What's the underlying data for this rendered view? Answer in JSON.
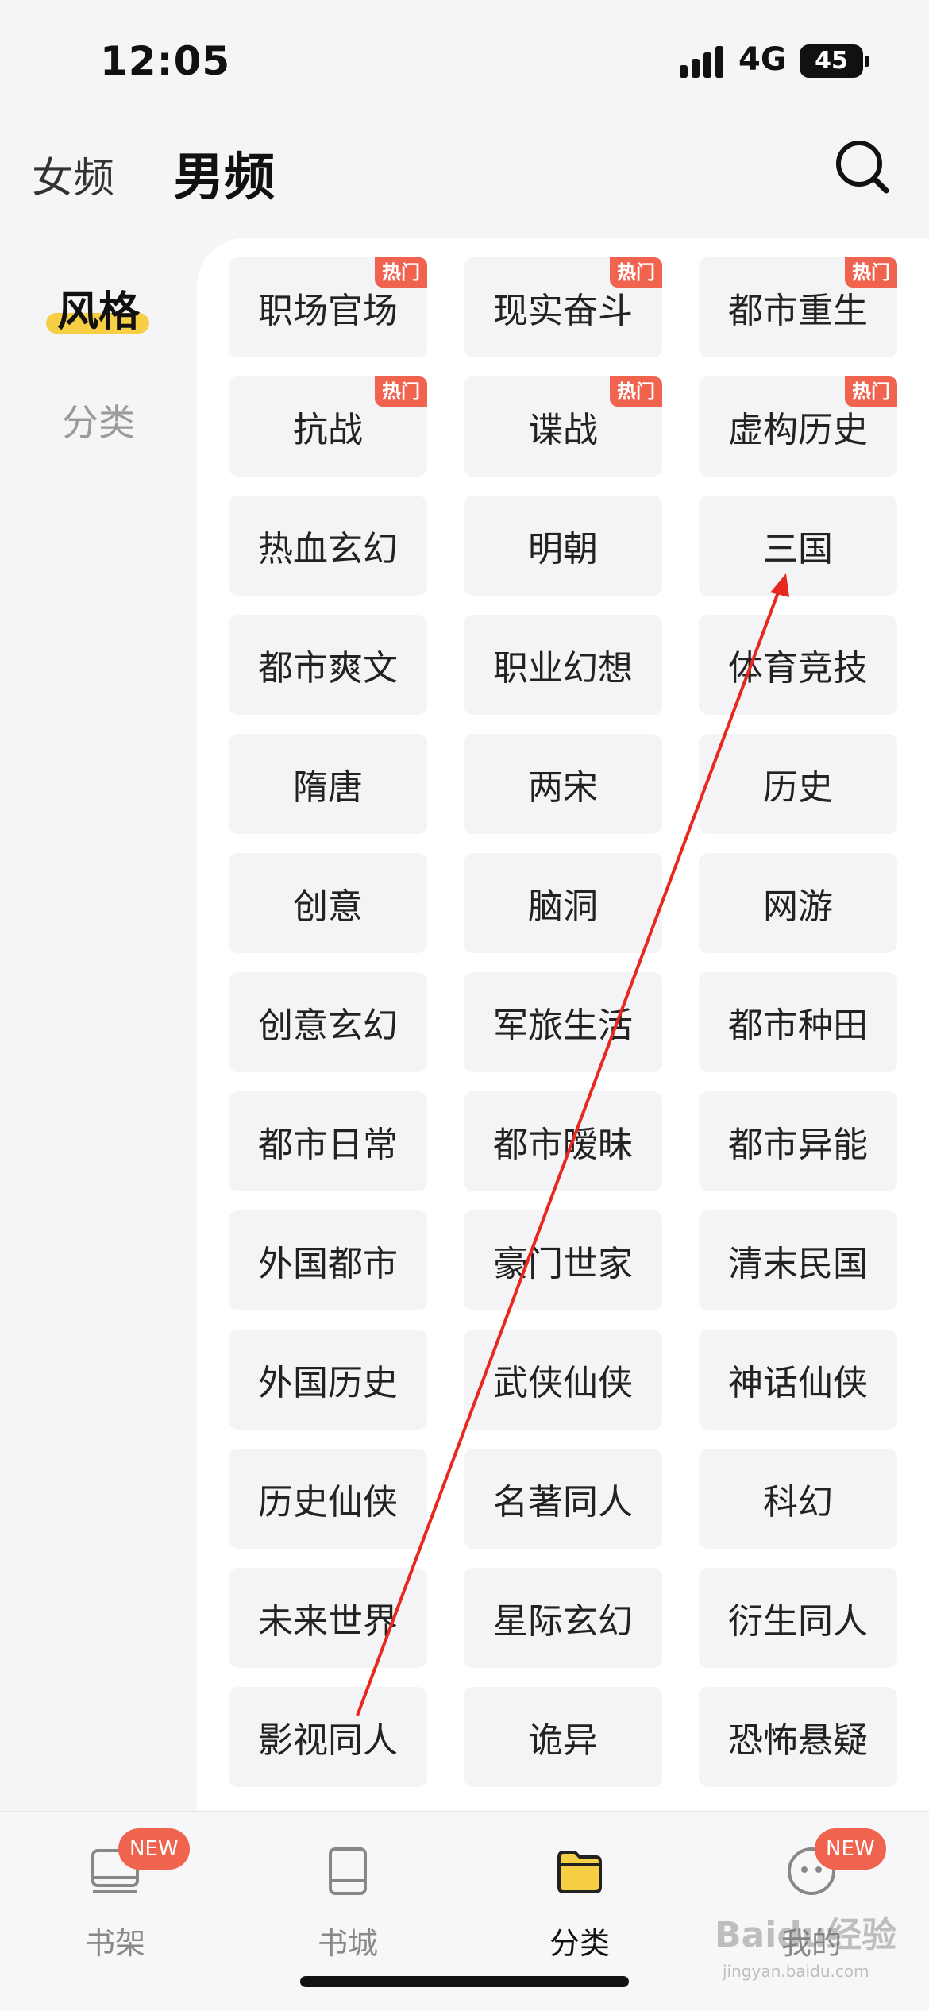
{
  "status": {
    "time": "12:05",
    "network": "4G",
    "battery": "45"
  },
  "header": {
    "tab_female": "女频",
    "tab_male": "男频",
    "search_icon": "search-icon"
  },
  "nav": {
    "style_label": "风格",
    "category_label": "分类"
  },
  "genres": [
    {
      "label": "职场官场",
      "badge": "热门"
    },
    {
      "label": "现实奋斗",
      "badge": "热门"
    },
    {
      "label": "都市重生",
      "badge": "热门"
    },
    {
      "label": "抗战",
      "badge": "热门"
    },
    {
      "label": "谍战",
      "badge": "热门"
    },
    {
      "label": "虚构历史",
      "badge": "热门"
    },
    {
      "label": "热血玄幻",
      "badge": ""
    },
    {
      "label": "明朝",
      "badge": ""
    },
    {
      "label": "三国",
      "badge": ""
    },
    {
      "label": "都市爽文",
      "badge": ""
    },
    {
      "label": "职业幻想",
      "badge": ""
    },
    {
      "label": "体育竞技",
      "badge": ""
    },
    {
      "label": "隋唐",
      "badge": ""
    },
    {
      "label": "两宋",
      "badge": ""
    },
    {
      "label": "历史",
      "badge": ""
    },
    {
      "label": "创意",
      "badge": ""
    },
    {
      "label": "脑洞",
      "badge": ""
    },
    {
      "label": "网游",
      "badge": ""
    },
    {
      "label": "创意玄幻",
      "badge": ""
    },
    {
      "label": "军旅生活",
      "badge": ""
    },
    {
      "label": "都市种田",
      "badge": ""
    },
    {
      "label": "都市日常",
      "badge": ""
    },
    {
      "label": "都市暧昧",
      "badge": ""
    },
    {
      "label": "都市异能",
      "badge": ""
    },
    {
      "label": "外国都市",
      "badge": ""
    },
    {
      "label": "豪门世家",
      "badge": ""
    },
    {
      "label": "清末民国",
      "badge": ""
    },
    {
      "label": "外国历史",
      "badge": ""
    },
    {
      "label": "武侠仙侠",
      "badge": ""
    },
    {
      "label": "神话仙侠",
      "badge": ""
    },
    {
      "label": "历史仙侠",
      "badge": ""
    },
    {
      "label": "名著同人",
      "badge": ""
    },
    {
      "label": "科幻",
      "badge": ""
    },
    {
      "label": "未来世界",
      "badge": ""
    },
    {
      "label": "星际玄幻",
      "badge": ""
    },
    {
      "label": "衍生同人",
      "badge": ""
    },
    {
      "label": "影视同人",
      "badge": ""
    },
    {
      "label": "诡异",
      "badge": ""
    },
    {
      "label": "恐怖悬疑",
      "badge": ""
    }
  ],
  "tabbar": {
    "tabs": [
      {
        "label": "书架",
        "badge": "NEW",
        "icon": "bookshelf-icon"
      },
      {
        "label": "书城",
        "badge": "",
        "icon": "book-icon"
      },
      {
        "label": "分类",
        "badge": "",
        "icon": "folder-icon",
        "active": true
      },
      {
        "label": "我的",
        "badge": "NEW",
        "icon": "profile-icon"
      }
    ]
  },
  "watermark": {
    "brand": "Baidu经验",
    "sub": "jingyan.baidu.com"
  },
  "colors": {
    "accent_yellow": "#f6cf44",
    "badge_red": "#f0634f",
    "arrow_red": "#e8281d"
  }
}
